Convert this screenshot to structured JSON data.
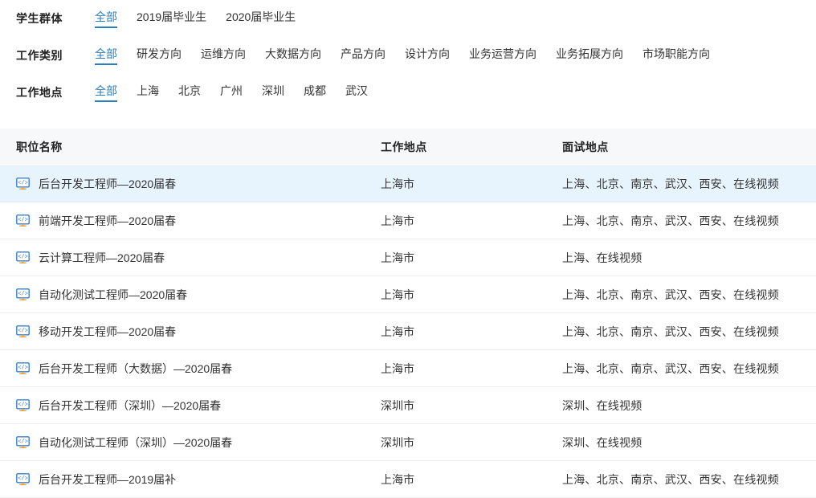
{
  "filters": [
    {
      "name": "student-group",
      "label": "学生群体",
      "options": [
        {
          "text": "全部",
          "active": true
        },
        {
          "text": "2019届毕业生",
          "active": false
        },
        {
          "text": "2020届毕业生",
          "active": false
        }
      ]
    },
    {
      "name": "job-category",
      "label": "工作类别",
      "options": [
        {
          "text": "全部",
          "active": true
        },
        {
          "text": "研发方向",
          "active": false
        },
        {
          "text": "运维方向",
          "active": false
        },
        {
          "text": "大数据方向",
          "active": false
        },
        {
          "text": "产品方向",
          "active": false
        },
        {
          "text": "设计方向",
          "active": false
        },
        {
          "text": "业务运营方向",
          "active": false
        },
        {
          "text": "业务拓展方向",
          "active": false
        },
        {
          "text": "市场职能方向",
          "active": false
        }
      ]
    },
    {
      "name": "work-location",
      "label": "工作地点",
      "options": [
        {
          "text": "全部",
          "active": true
        },
        {
          "text": "上海",
          "active": false
        },
        {
          "text": "北京",
          "active": false
        },
        {
          "text": "广州",
          "active": false
        },
        {
          "text": "深圳",
          "active": false
        },
        {
          "text": "成都",
          "active": false
        },
        {
          "text": "武汉",
          "active": false
        }
      ]
    }
  ],
  "table": {
    "columns": {
      "title": "职位名称",
      "work_location": "工作地点",
      "interview_location": "面试地点"
    },
    "rows": [
      {
        "icon": "code-monitor-icon",
        "title": "后台开发工程师—2020届春",
        "work_location": "上海市",
        "interview_location": "上海、北京、南京、武汉、西安、在线视频",
        "highlighted": true
      },
      {
        "icon": "code-monitor-icon",
        "title": "前端开发工程师—2020届春",
        "work_location": "上海市",
        "interview_location": "上海、北京、南京、武汉、西安、在线视频",
        "highlighted": false
      },
      {
        "icon": "code-monitor-icon",
        "title": "云计算工程师—2020届春",
        "work_location": "上海市",
        "interview_location": "上海、在线视频",
        "highlighted": false
      },
      {
        "icon": "code-monitor-icon",
        "title": "自动化测试工程师—2020届春",
        "work_location": "上海市",
        "interview_location": "上海、北京、南京、武汉、西安、在线视频",
        "highlighted": false
      },
      {
        "icon": "code-monitor-icon",
        "title": "移动开发工程师—2020届春",
        "work_location": "上海市",
        "interview_location": "上海、北京、南京、武汉、西安、在线视频",
        "highlighted": false
      },
      {
        "icon": "code-monitor-icon",
        "title": "后台开发工程师（大数据）—2020届春",
        "work_location": "上海市",
        "interview_location": "上海、北京、南京、武汉、西安、在线视频",
        "highlighted": false
      },
      {
        "icon": "code-monitor-icon",
        "title": "后台开发工程师（深圳）—2020届春",
        "work_location": "深圳市",
        "interview_location": "深圳、在线视频",
        "highlighted": false
      },
      {
        "icon": "code-monitor-icon",
        "title": "自动化测试工程师（深圳）—2020届春",
        "work_location": "深圳市",
        "interview_location": "深圳、在线视频",
        "highlighted": false
      },
      {
        "icon": "code-monitor-icon",
        "title": "后台开发工程师—2019届补",
        "work_location": "上海市",
        "interview_location": "上海、北京、南京、武汉、西安、在线视频",
        "highlighted": false
      }
    ]
  },
  "colors": {
    "accent": "#2a7fc1",
    "row_highlight": "#e8f4fd",
    "header_bg": "#f7f8fa",
    "divider": "#eeeeee",
    "text": "#333333"
  }
}
